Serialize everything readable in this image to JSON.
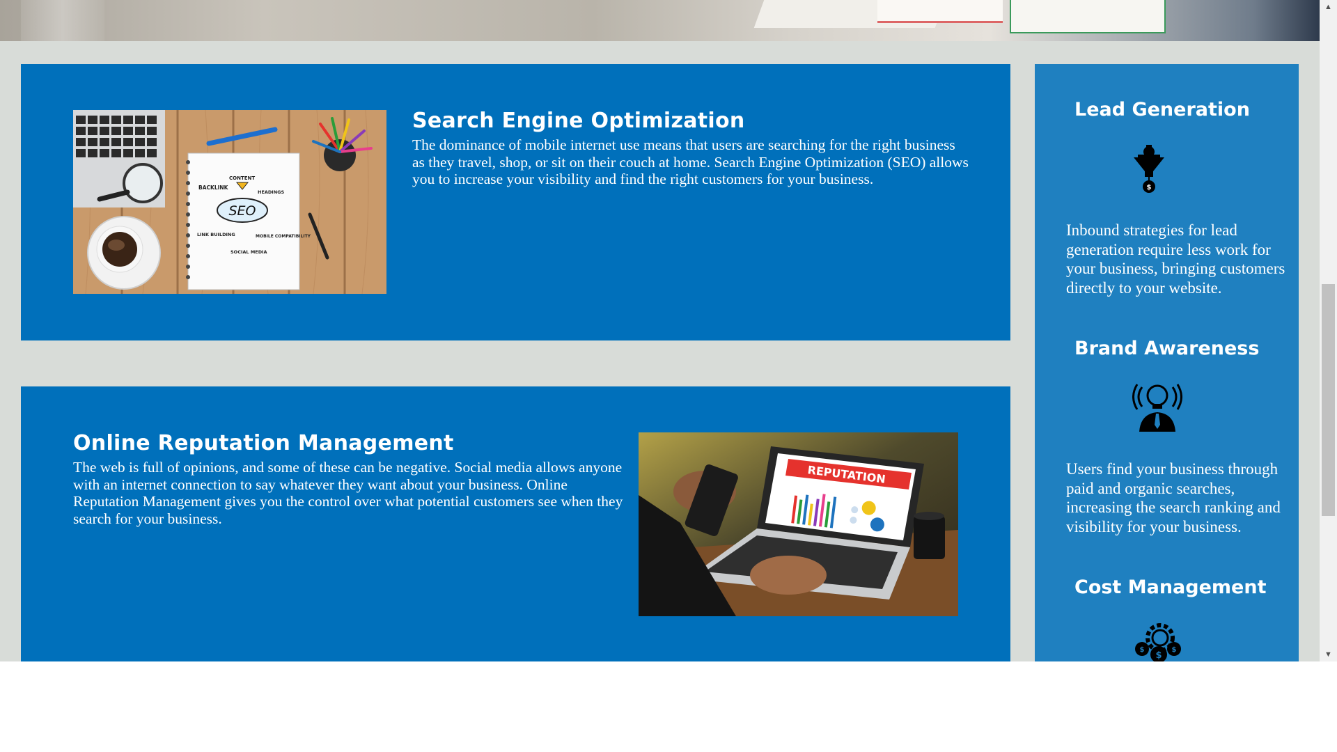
{
  "services": [
    {
      "title": "Search Engine Optimization",
      "description": "The dominance of mobile internet use means that users are searching for the right business as they travel, shop, or sit on their couch at home. Search Engine Optimization (SEO) allows you to increase your visibility and find the right customers for your business.",
      "image": {
        "notepad_words": [
          "CONTENT",
          "BACKLINK",
          "HEADINGS",
          "SEO",
          "LINK BUILDING",
          "MOBILE COMPATIBILITY",
          "SOCIAL MEDIA"
        ]
      }
    },
    {
      "title": "Online Reputation Management",
      "description": "The web is full of opinions, and some of these can be negative. Social media allows anyone with an internet connection to say whatever they want about your business. Online Reputation Management gives you the control over what potential customers see when they search for your business.",
      "image": {
        "screen_banner": "REPUTATION"
      }
    }
  ],
  "benefits": [
    {
      "title": "Lead Generation",
      "icon": "funnel-money-icon",
      "text": "Inbound strategies for lead generation require less work for your business, bringing customers directly to your website."
    },
    {
      "title": "Brand Awareness",
      "icon": "lightbulb-person-icon",
      "text": "Users find your business through paid and organic searches, increasing the search ranking and visibility for your business."
    },
    {
      "title": "Cost Management",
      "icon": "gear-money-icon",
      "text": ""
    }
  ],
  "colors": {
    "page_background": "#d8dcd8",
    "card_blue": "#0070bb",
    "sidebar_blue": "#1f80c0",
    "text": "#ffffff"
  }
}
